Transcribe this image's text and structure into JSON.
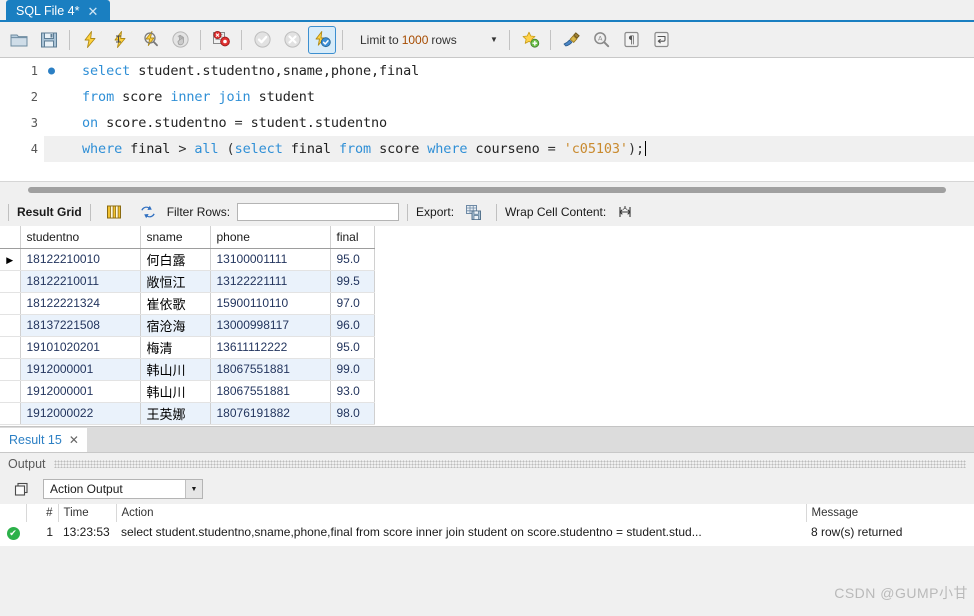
{
  "tab": {
    "title": "SQL File 4*",
    "close": "✕"
  },
  "toolbar": {
    "icons": [
      "open-folder-icon",
      "save-icon",
      "execute-icon",
      "execute-current-icon",
      "explain-icon",
      "stop-icon",
      "toggle-stop-on-error-icon",
      "commit-icon",
      "rollback-icon",
      "toggle-autocommit-icon"
    ],
    "limit_prefix": "Limit to",
    "limit_value": "1000",
    "limit_suffix": "rows",
    "right_icons": [
      "add-snippet-icon",
      "beautify-icon",
      "find-icon",
      "show-invisible-chars-icon",
      "wrap-lines-icon"
    ]
  },
  "editor": {
    "lines": [
      {
        "no": "1",
        "bullet": true,
        "current": false,
        "tokens": [
          {
            "t": "select ",
            "c": "kw"
          },
          {
            "t": "student.studentno,sname,phone,final",
            "c": "id"
          }
        ]
      },
      {
        "no": "2",
        "bullet": false,
        "current": false,
        "tokens": [
          {
            "t": "from ",
            "c": "kw"
          },
          {
            "t": "score ",
            "c": "id"
          },
          {
            "t": "inner join ",
            "c": "kw"
          },
          {
            "t": "student",
            "c": "id"
          }
        ]
      },
      {
        "no": "3",
        "bullet": false,
        "current": false,
        "tokens": [
          {
            "t": "on ",
            "c": "kw"
          },
          {
            "t": "score.studentno ",
            "c": "id"
          },
          {
            "t": "= ",
            "c": "op"
          },
          {
            "t": "student.studentno",
            "c": "id"
          }
        ]
      },
      {
        "no": "4",
        "bullet": false,
        "current": true,
        "tokens": [
          {
            "t": "where ",
            "c": "kw"
          },
          {
            "t": "final ",
            "c": "id"
          },
          {
            "t": "> ",
            "c": "op"
          },
          {
            "t": "all ",
            "c": "kw"
          },
          {
            "t": "(",
            "c": "op"
          },
          {
            "t": "select ",
            "c": "kw"
          },
          {
            "t": "final ",
            "c": "id"
          },
          {
            "t": "from ",
            "c": "kw"
          },
          {
            "t": "score ",
            "c": "id"
          },
          {
            "t": "where ",
            "c": "kw"
          },
          {
            "t": "courseno ",
            "c": "id"
          },
          {
            "t": "= ",
            "c": "op"
          },
          {
            "t": "'c05103'",
            "c": "str"
          },
          {
            "t": ");",
            "c": "op"
          }
        ]
      }
    ]
  },
  "gridbar": {
    "result_grid_label": "Result Grid",
    "form_editor_icon": "form-editor-icon",
    "refresh_icon": "refresh-icon",
    "filter_label": "Filter Rows:",
    "filter_value": "",
    "filter_placeholder": "",
    "export_label": "Export:",
    "export_icon": "export-recordset-icon",
    "wrap_label": "Wrap Cell Content:",
    "wrap_icon": "wrap-cell-icon"
  },
  "results": {
    "columns": [
      "studentno",
      "sname",
      "phone",
      "final"
    ],
    "rows": [
      {
        "selected": true,
        "studentno": "18122210010",
        "sname": "何白露",
        "phone": "13100001111",
        "final": "95.0"
      },
      {
        "selected": false,
        "studentno": "18122210011",
        "sname": "敞恒江",
        "phone": "13122221111",
        "final": "99.5"
      },
      {
        "selected": false,
        "studentno": "18122221324",
        "sname": "崔依歌",
        "phone": "15900110110",
        "final": "97.0"
      },
      {
        "selected": false,
        "studentno": "18137221508",
        "sname": "宿沧海",
        "phone": "13000998117",
        "final": "96.0"
      },
      {
        "selected": false,
        "studentno": "19101020201",
        "sname": "梅清",
        "phone": "13611112222",
        "final": "95.0"
      },
      {
        "selected": false,
        "studentno": "1912000001",
        "sname": "韩山川",
        "phone": "18067551881",
        "final": "99.0"
      },
      {
        "selected": false,
        "studentno": "1912000001",
        "sname": "韩山川",
        "phone": "18067551881",
        "final": "93.0"
      },
      {
        "selected": false,
        "studentno": "1912000022",
        "sname": "王英娜",
        "phone": "18076191882",
        "final": "98.0"
      }
    ]
  },
  "result_tab": {
    "label": "Result 15",
    "close": "✕"
  },
  "output": {
    "header": "Output",
    "panel_icon": "output-panel-icon",
    "selector_value": "Action Output",
    "columns": {
      "status": "",
      "index": "#",
      "time": "Time",
      "action": "Action",
      "message": "Message"
    },
    "rows": [
      {
        "status": "success",
        "index": "1",
        "time": "13:23:53",
        "action": "select student.studentno,sname,phone,final  from score inner join student  on score.studentno = student.stud...",
        "message": "8 row(s) returned"
      }
    ]
  },
  "watermark": "CSDN @GUMP小甘",
  "colors": {
    "tab_active": "#1a7fc1",
    "keyword": "#2f8fd6",
    "string": "#c98a2e",
    "alt_row": "#eaf2fb",
    "success": "#2cb14a",
    "link": "#2b7fc4"
  }
}
